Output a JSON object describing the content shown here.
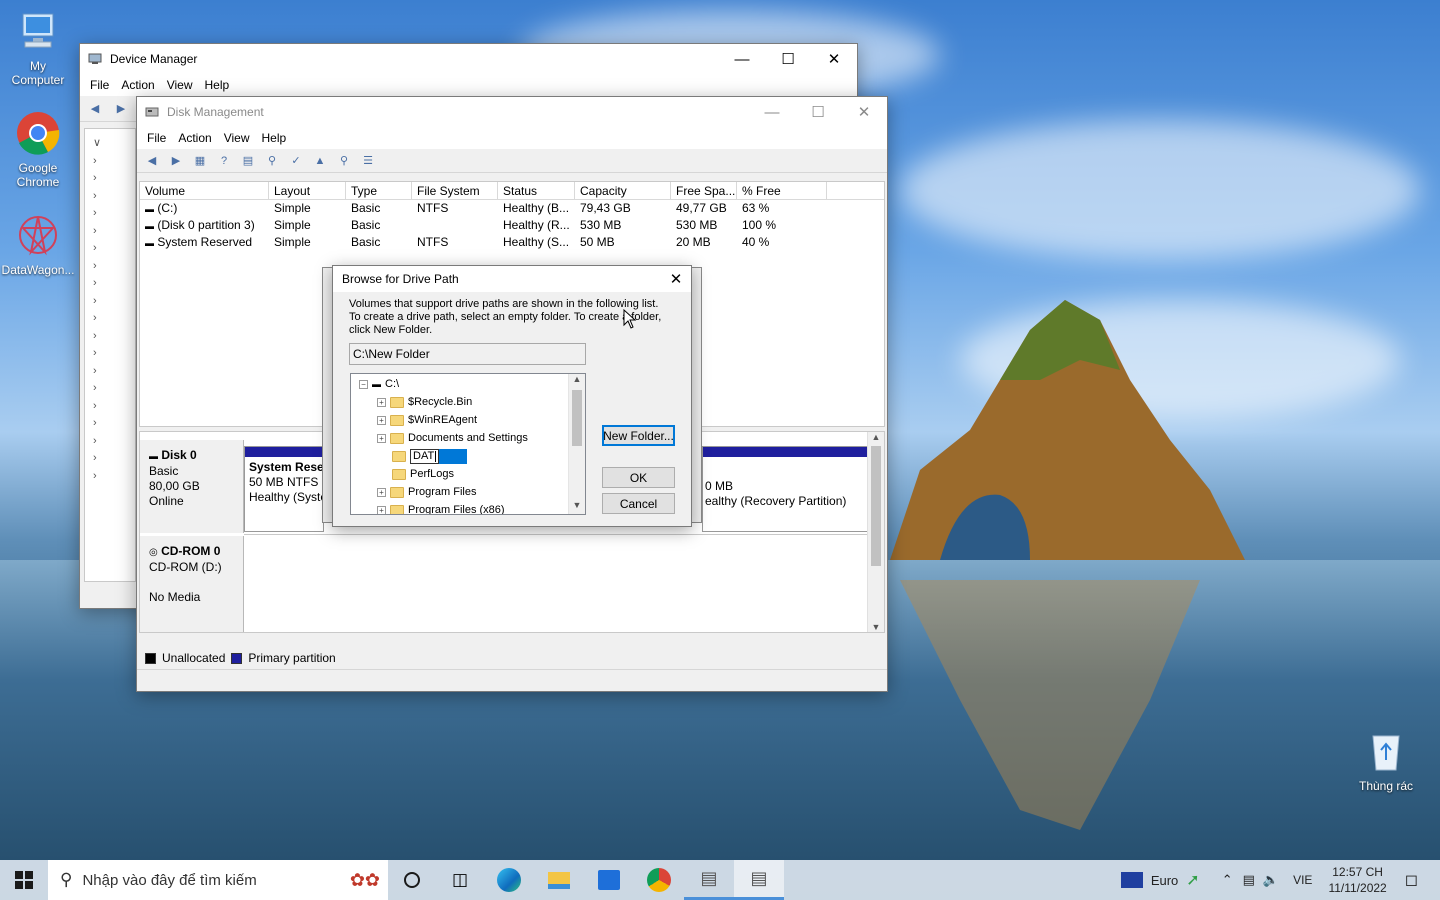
{
  "desktop": {
    "icons": [
      {
        "label": "My\nComputer",
        "name": "my-computer"
      },
      {
        "label": "Google\nChrome",
        "name": "google-chrome"
      },
      {
        "label": "DataWagon...",
        "name": "datawagon"
      }
    ],
    "recycle_bin_label": "Thùng rác"
  },
  "device_manager": {
    "title": "Device Manager",
    "menu": [
      "File",
      "Action",
      "View",
      "Help"
    ]
  },
  "disk_management": {
    "title": "Disk Management",
    "menu": [
      "File",
      "Action",
      "View",
      "Help"
    ],
    "columns": [
      "Volume",
      "Layout",
      "Type",
      "File System",
      "Status",
      "Capacity",
      "Free Spa...",
      "% Free"
    ],
    "rows": [
      [
        "(C:)",
        "Simple",
        "Basic",
        "NTFS",
        "Healthy (B...",
        "79,43 GB",
        "49,77 GB",
        "63 %"
      ],
      [
        "(Disk 0 partition 3)",
        "Simple",
        "Basic",
        "",
        "Healthy (R...",
        "530 MB",
        "530 MB",
        "100 %"
      ],
      [
        "System Reserved",
        "Simple",
        "Basic",
        "NTFS",
        "Healthy (S...",
        "50 MB",
        "20 MB",
        "40 %"
      ]
    ],
    "disk0": {
      "name": "Disk 0",
      "type": "Basic",
      "size": "80,00 GB",
      "state": "Online",
      "part1_title": "System Rese",
      "part1_fs": "50 MB NTFS",
      "part1_status": "Healthy (Syste",
      "part3_size": "0 MB",
      "part3_status": "ealthy (Recovery Partition)"
    },
    "cdrom": {
      "name": "CD-ROM 0",
      "type": "CD-ROM (D:)",
      "state": "No Media"
    },
    "legend": {
      "unallocated": "Unallocated",
      "primary": "Primary partition"
    },
    "colors": {
      "primary": "#1f1f9e",
      "unallocated": "#000000"
    }
  },
  "dialog": {
    "title": "Browse for Drive Path",
    "description_line1": "Volumes that support drive paths are shown in the following list.",
    "description_line2": "To create a drive path, select an empty folder. To create a folder,",
    "description_line3": "click New Folder.",
    "path_value": "C:\\New Folder",
    "tree": [
      {
        "label": "C:\\",
        "level": 0,
        "expander": "-"
      },
      {
        "label": "$Recycle.Bin",
        "level": 1,
        "expander": "+"
      },
      {
        "label": "$WinREAgent",
        "level": 1,
        "expander": "+"
      },
      {
        "label": "Documents and Settings",
        "level": 1,
        "expander": "+"
      },
      {
        "label": "DAT",
        "level": 1,
        "expander": "",
        "editing": true
      },
      {
        "label": "PerfLogs",
        "level": 1,
        "expander": ""
      },
      {
        "label": "Program Files",
        "level": 1,
        "expander": "+"
      },
      {
        "label": "Program Files (x86)",
        "level": 1,
        "expander": "+"
      }
    ],
    "new_folder_button": "New Folder...",
    "ok_button": "OK",
    "cancel_button": "Cancel"
  },
  "taskbar": {
    "search_placeholder": "Nhập vào đây để tìm kiếm",
    "currency": "Euro",
    "language": "VIE",
    "time": "12:57 CH",
    "date": "11/11/2022"
  }
}
